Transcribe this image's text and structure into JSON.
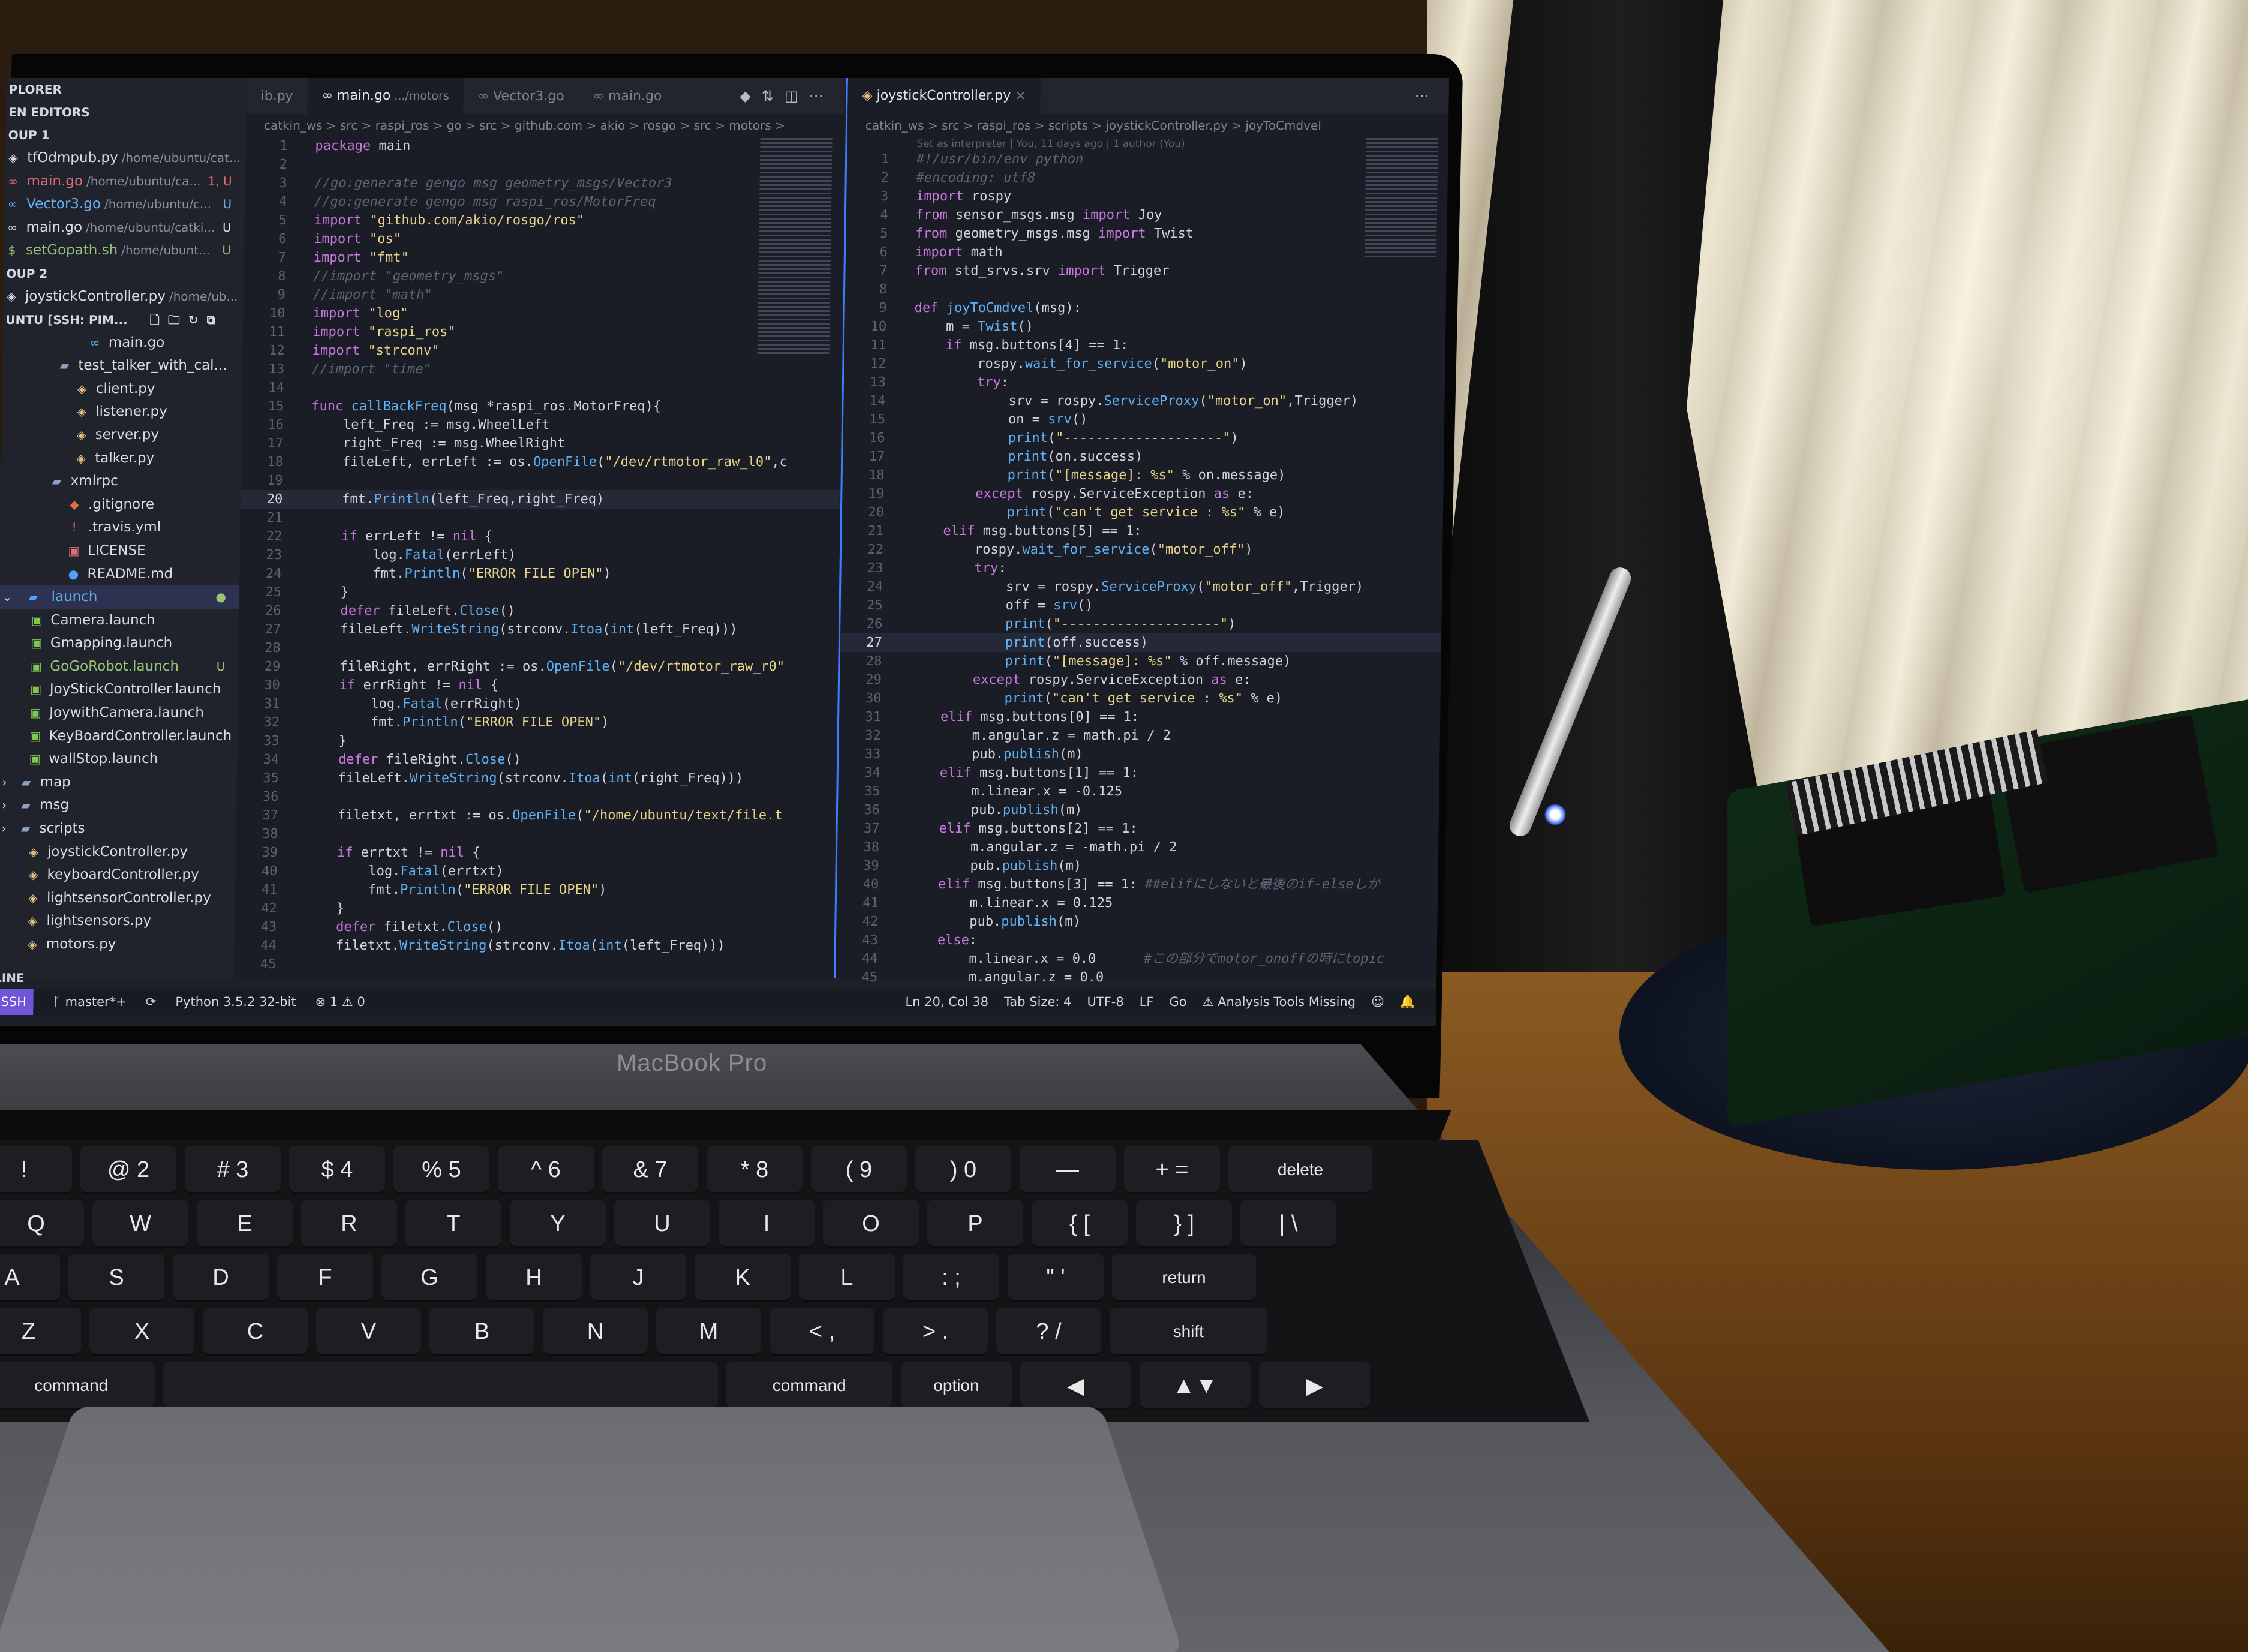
{
  "device": {
    "brand": "MacBook Pro"
  },
  "sidebar": {
    "explorer_title": "PLORER",
    "open_editors_title": "EN EDITORS",
    "group1": "OUP 1",
    "group1_files": [
      {
        "name": "tfOdmpub.py",
        "path": "/home/ubuntu/cat...",
        "status": "",
        "cls": ""
      },
      {
        "name": "main.go",
        "path": "/home/ubuntu/ca...",
        "status": "1, U",
        "cls": "mod"
      },
      {
        "name": "Vector3.go",
        "path": "/home/ubuntu/c...",
        "status": "U",
        "cls": "add"
      },
      {
        "name": "main.go",
        "path": "/home/ubuntu/catki...",
        "status": "U",
        "cls": ""
      },
      {
        "name": "setGopath.sh",
        "path": "/home/ubunt...",
        "status": "U",
        "cls": "new"
      }
    ],
    "group2": "OUP 2",
    "group2_files": [
      {
        "name": "joystickController.py",
        "path": "/home/ub...",
        "status": ""
      }
    ],
    "workspace": "UNTU [SSH: PIM...",
    "tree": [
      {
        "name": "main.go",
        "icon": "go",
        "indent": 140
      },
      {
        "name": "test_talker_with_cal...",
        "icon": "folder",
        "indent": 90
      },
      {
        "name": "client.py",
        "icon": "python",
        "indent": 120
      },
      {
        "name": "listener.py",
        "icon": "python",
        "indent": 120
      },
      {
        "name": "server.py",
        "icon": "python",
        "indent": 120
      },
      {
        "name": "talker.py",
        "icon": "python",
        "indent": 120
      },
      {
        "name": "xmlrpc",
        "icon": "folder",
        "indent": 80
      },
      {
        "name": ".gitignore",
        "icon": "git",
        "indent": 110
      },
      {
        "name": ".travis.yml",
        "icon": "yml",
        "indent": 110
      },
      {
        "name": "LICENSE",
        "icon": "license",
        "indent": 110
      },
      {
        "name": "README.md",
        "icon": "info",
        "indent": 110
      }
    ],
    "launch_folder": "launch",
    "launch_files": [
      {
        "name": "Camera.launch",
        "status": ""
      },
      {
        "name": "Gmapping.launch",
        "status": ""
      },
      {
        "name": "GoGoRobot.launch",
        "status": "U"
      },
      {
        "name": "JoyStickController.launch",
        "status": ""
      },
      {
        "name": "JoywithCamera.launch",
        "status": ""
      },
      {
        "name": "KeyBoardController.launch",
        "status": ""
      },
      {
        "name": "wallStop.launch",
        "status": ""
      }
    ],
    "folders": [
      "map",
      "msg",
      "scripts"
    ],
    "script_files": [
      "joystickController.py",
      "keyboardController.py",
      "lightsensorController.py",
      "lightsensors.py",
      "motors.py"
    ],
    "outline_title": "LINE"
  },
  "editor1": {
    "tabs": [
      {
        "label": "ib.py",
        "sub": ""
      },
      {
        "label": "main.go",
        "sub": ".../motors"
      },
      {
        "label": "Vector3.go",
        "sub": ""
      },
      {
        "label": "main.go",
        "sub": ""
      }
    ],
    "breadcrumb": "catkin_ws > src > raspi_ros > go > src > github.com > akio > rosgo > src > motors > ",
    "lines": [
      [
        "1",
        "package main"
      ],
      [
        "2",
        ""
      ],
      [
        "3",
        "//go:generate gengo msg geometry_msgs/Vector3"
      ],
      [
        "4",
        "//go:generate gengo msg raspi_ros/MotorFreq"
      ],
      [
        "5",
        "import \"github.com/akio/rosgo/ros\""
      ],
      [
        "6",
        "import \"os\""
      ],
      [
        "7",
        "import \"fmt\""
      ],
      [
        "8",
        "//import \"geometry_msgs\""
      ],
      [
        "9",
        "//import \"math\""
      ],
      [
        "10",
        "import \"log\""
      ],
      [
        "11",
        "import \"raspi_ros\""
      ],
      [
        "12",
        "import \"strconv\""
      ],
      [
        "13",
        "//import \"time\""
      ],
      [
        "14",
        ""
      ],
      [
        "15",
        "func callBackFreq(msg *raspi_ros.MotorFreq){"
      ],
      [
        "16",
        "    left_Freq := msg.WheelLeft"
      ],
      [
        "17",
        "    right_Freq := msg.WheelRight"
      ],
      [
        "18",
        "    fileLeft, errLeft := os.OpenFile(\"/dev/rtmotor_raw_l0\",c"
      ],
      [
        "19",
        ""
      ],
      [
        "20",
        "    fmt.Println(left_Freq,right_Freq)"
      ],
      [
        "21",
        ""
      ],
      [
        "22",
        "    if errLeft != nil {"
      ],
      [
        "23",
        "        log.Fatal(errLeft)"
      ],
      [
        "24",
        "        fmt.Println(\"ERROR FILE OPEN\")"
      ],
      [
        "25",
        "    }"
      ],
      [
        "26",
        "    defer fileLeft.Close()"
      ],
      [
        "27",
        "    fileLeft.WriteString(strconv.Itoa(int(left_Freq)))"
      ],
      [
        "28",
        ""
      ],
      [
        "29",
        "    fileRight, errRight := os.OpenFile(\"/dev/rtmotor_raw_r0\""
      ],
      [
        "30",
        "    if errRight != nil {"
      ],
      [
        "31",
        "        log.Fatal(errRight)"
      ],
      [
        "32",
        "        fmt.Println(\"ERROR FILE OPEN\")"
      ],
      [
        "33",
        "    }"
      ],
      [
        "34",
        "    defer fileRight.Close()"
      ],
      [
        "35",
        "    fileLeft.WriteString(strconv.Itoa(int(right_Freq)))"
      ],
      [
        "36",
        ""
      ],
      [
        "37",
        "    filetxt, errtxt := os.OpenFile(\"/home/ubuntu/text/file.t"
      ],
      [
        "38",
        ""
      ],
      [
        "39",
        "    if errtxt != nil {"
      ],
      [
        "40",
        "        log.Fatal(errtxt)"
      ],
      [
        "41",
        "        fmt.Println(\"ERROR FILE OPEN\")"
      ],
      [
        "42",
        "    }"
      ],
      [
        "43",
        "    defer filetxt.Close()"
      ],
      [
        "44",
        "    filetxt.WriteString(strconv.Itoa(int(left_Freq)))"
      ],
      [
        "45",
        ""
      ]
    ],
    "current_line": "20"
  },
  "editor2": {
    "tab": "joystickController.py",
    "breadcrumb": "catkin_ws > src > raspi_ros > scripts > joystickController.py > joyToCmdvel",
    "blame": "Set as interpreter | You, 11 days ago | 1 author (You)",
    "lines": [
      [
        "1",
        "#!/usr/bin/env python"
      ],
      [
        "2",
        "#encoding: utf8"
      ],
      [
        "3",
        "import rospy"
      ],
      [
        "4",
        "from sensor_msgs.msg import Joy"
      ],
      [
        "5",
        "from geometry_msgs.msg import Twist"
      ],
      [
        "6",
        "import math"
      ],
      [
        "7",
        "from std_srvs.srv import Trigger"
      ],
      [
        "8",
        ""
      ],
      [
        "9",
        "def joyToCmdvel(msg):"
      ],
      [
        "10",
        "    m = Twist()"
      ],
      [
        "11",
        "    if msg.buttons[4] == 1:"
      ],
      [
        "12",
        "        rospy.wait_for_service(\"motor_on\")"
      ],
      [
        "13",
        "        try:"
      ],
      [
        "14",
        "            srv = rospy.ServiceProxy(\"motor_on\",Trigger)"
      ],
      [
        "15",
        "            on = srv()"
      ],
      [
        "16",
        "            print(\"--------------------\")"
      ],
      [
        "17",
        "            print(on.success)"
      ],
      [
        "18",
        "            print(\"[message]: %s\" % on.message)"
      ],
      [
        "19",
        "        except rospy.ServiceException as e:"
      ],
      [
        "20",
        "            print(\"can't get service : %s\" % e)"
      ],
      [
        "21",
        "    elif msg.buttons[5] == 1:"
      ],
      [
        "22",
        "        rospy.wait_for_service(\"motor_off\")"
      ],
      [
        "23",
        "        try:"
      ],
      [
        "24",
        "            srv = rospy.ServiceProxy(\"motor_off\",Trigger)"
      ],
      [
        "25",
        "            off = srv()"
      ],
      [
        "26",
        "            print(\"--------------------\")"
      ],
      [
        "27",
        "            print(off.success)"
      ],
      [
        "28",
        "            print(\"[message]: %s\" % off.message)"
      ],
      [
        "29",
        "        except rospy.ServiceException as e:"
      ],
      [
        "30",
        "            print(\"can't get service : %s\" % e)"
      ],
      [
        "31",
        "    elif msg.buttons[0] == 1:"
      ],
      [
        "32",
        "        m.angular.z = math.pi / 2"
      ],
      [
        "33",
        "        pub.publish(m)"
      ],
      [
        "34",
        "    elif msg.buttons[1] == 1:"
      ],
      [
        "35",
        "        m.linear.x = -0.125"
      ],
      [
        "36",
        "        pub.publish(m)"
      ],
      [
        "37",
        "    elif msg.buttons[2] == 1:"
      ],
      [
        "38",
        "        m.angular.z = -math.pi / 2"
      ],
      [
        "39",
        "        pub.publish(m)"
      ],
      [
        "40",
        "    elif msg.buttons[3] == 1: ##elifにしないと最後のif-elseしか"
      ],
      [
        "41",
        "        m.linear.x = 0.125"
      ],
      [
        "42",
        "        pub.publish(m)"
      ],
      [
        "43",
        "    else:"
      ],
      [
        "44",
        "        m.linear.x = 0.0      #この部分でmotor_onoffの時にtopic"
      ],
      [
        "45",
        "        m.angular.z = 0.0"
      ]
    ],
    "current_line": "27"
  },
  "statusbar": {
    "remote": "SSH",
    "branch": "master*+",
    "python": "Python 3.5.2 32-bit",
    "problems": "⊗ 1 ⚠ 0",
    "position": "Ln 20, Col 38",
    "tab_size": "Tab Size: 4",
    "encoding": "UTF-8",
    "eol": "LF",
    "lang": "Go",
    "warning": "Analysis Tools Missing"
  },
  "keyboard": {
    "row1": [
      "!",
      "@ 2",
      "# 3",
      "$ 4",
      "% 5",
      "^ 6",
      "& 7",
      "* 8",
      "( 9",
      ") 0",
      "—",
      "+ =",
      "delete"
    ],
    "row2": [
      "Q",
      "W",
      "E",
      "R",
      "T",
      "Y",
      "U",
      "I",
      "O",
      "P",
      "{ [",
      "} ]",
      "| \\"
    ],
    "row3": [
      "A",
      "S",
      "D",
      "F",
      "G",
      "H",
      "J",
      "K",
      "L",
      ": ;",
      "\" '",
      "return"
    ],
    "row4": [
      "Z",
      "X",
      "C",
      "V",
      "B",
      "N",
      "M",
      "< ,",
      "> .",
      "? /",
      "shift"
    ],
    "row5": [
      "command",
      "",
      "command",
      "option",
      "◀",
      "▲▼",
      "▶"
    ]
  },
  "colors": {
    "accent": "#3d7eff",
    "status_badge": "#6f56d9"
  }
}
